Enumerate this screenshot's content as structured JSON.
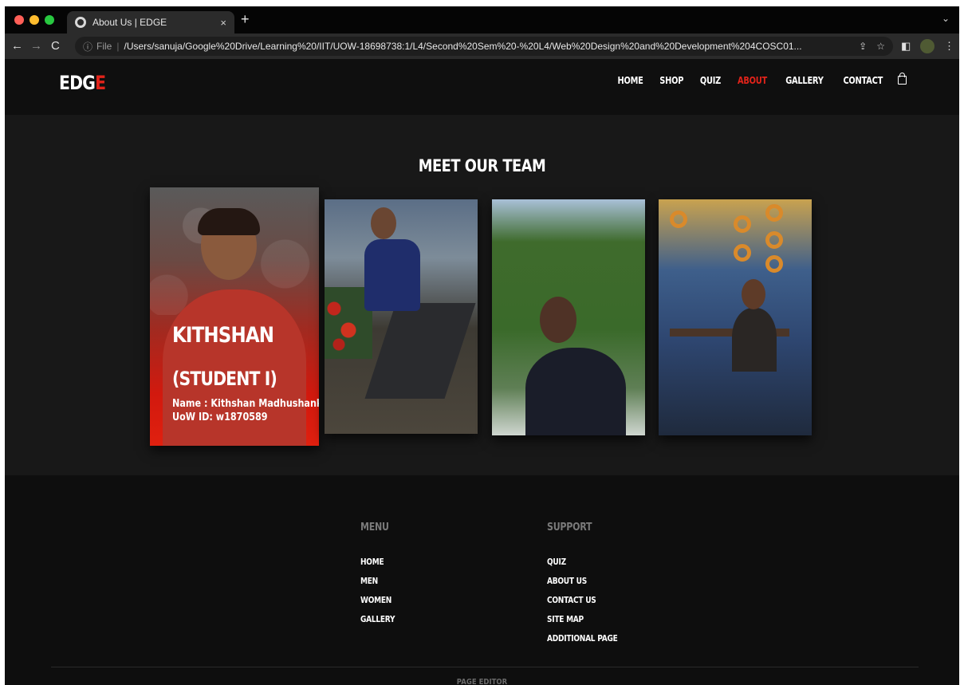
{
  "browser": {
    "tab_title": "About Us | EDGE",
    "tab_close": "×",
    "new_tab": "+",
    "tab_menu": "⌄",
    "back": "←",
    "forward": "→",
    "reload": "C",
    "info": "ⓘ",
    "scheme": "File",
    "separator": "|",
    "url": "/Users/sanuja/Google%20Drive/Learning%20/IIT/UOW-18698738:1/L4/Second%20Sem%20-%20L4/Web%20Design%20and%20Development%204COSC01...",
    "share": "⇪",
    "star": "☆",
    "panel": "◧",
    "kebab": "⋮"
  },
  "header": {
    "logo_text": "EDG",
    "logo_accent": "E",
    "nav": [
      {
        "label": "HOME",
        "active": false
      },
      {
        "label": "SHOP",
        "active": false
      },
      {
        "label": "QUIZ",
        "active": false
      },
      {
        "label": "ABOUT",
        "active": true
      },
      {
        "label": "GALLERY",
        "active": false
      },
      {
        "label": "CONTACT",
        "active": false
      }
    ]
  },
  "team": {
    "title": "MEET OUR TEAM",
    "featured": {
      "name": "KITHSHAN",
      "role": "(STUDENT I)",
      "detail_name": "Name : Kithshan Madhushanka",
      "detail_id": "UoW ID: w1870589"
    }
  },
  "footer": {
    "menu_heading": "MENU",
    "menu_links": [
      "HOME",
      "MEN",
      "WOMEN",
      "GALLERY"
    ],
    "support_heading": "SUPPORT",
    "support_links": [
      "QUIZ",
      "ABOUT US",
      "CONTACT US",
      "SITE MAP",
      "ADDITIONAL PAGE"
    ],
    "credit": "PAGE EDITOR"
  },
  "colors": {
    "accent": "#e2231a",
    "background": "#121212"
  }
}
